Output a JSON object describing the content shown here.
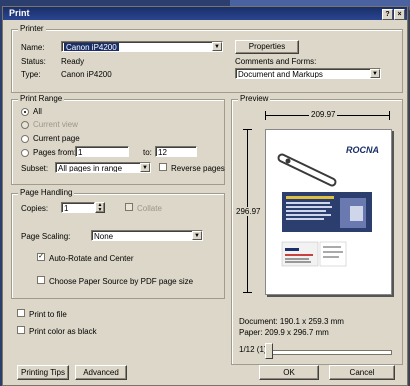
{
  "window": {
    "title": "Print"
  },
  "titlebar_buttons": {
    "help": "?",
    "close": "×"
  },
  "printer": {
    "group_label": "Printer",
    "name_label": "Name:",
    "name_value": "Canon iP4200",
    "properties_label": "Properties",
    "status_label": "Status:",
    "status_value": "Ready",
    "type_label": "Type:",
    "type_value": "Canon iP4200",
    "comments_label": "Comments and Forms:",
    "comments_value": "Document and Markups"
  },
  "print_range": {
    "group_label": "Print Range",
    "all_label": "All",
    "current_view_label": "Current view",
    "current_page_label": "Current page",
    "pages_from_label": "Pages from:",
    "pages_from_value": "1",
    "to_label": "to:",
    "to_value": "12",
    "subset_label": "Subset:",
    "subset_value": "All pages in range",
    "reverse_label": "Reverse pages",
    "selected": "All"
  },
  "page_handling": {
    "group_label": "Page Handling",
    "copies_label": "Copies:",
    "copies_value": "1",
    "collate_label": "Collate",
    "scaling_label": "Page Scaling:",
    "scaling_value": "None",
    "auto_rotate_label": "Auto-Rotate and Center",
    "auto_rotate_checked": true,
    "choose_source_label": "Choose Paper Source by PDF page size",
    "choose_source_checked": false
  },
  "options": {
    "print_to_file_label": "Print to file",
    "print_color_black_label": "Print color as black"
  },
  "preview": {
    "group_label": "Preview",
    "width_value": "209.97",
    "height_value": "296.97",
    "document_size": "Document: 190.1 x 259.3 mm",
    "paper_size": "Paper: 209.9 x 296.7 mm",
    "page_indicator": "1/12 (1)",
    "logo_text": "ROCNA",
    "slider_position": 0
  },
  "footer": {
    "tips_label": "Printing Tips",
    "advanced_label": "Advanced",
    "ok_label": "OK",
    "cancel_label": "Cancel"
  }
}
